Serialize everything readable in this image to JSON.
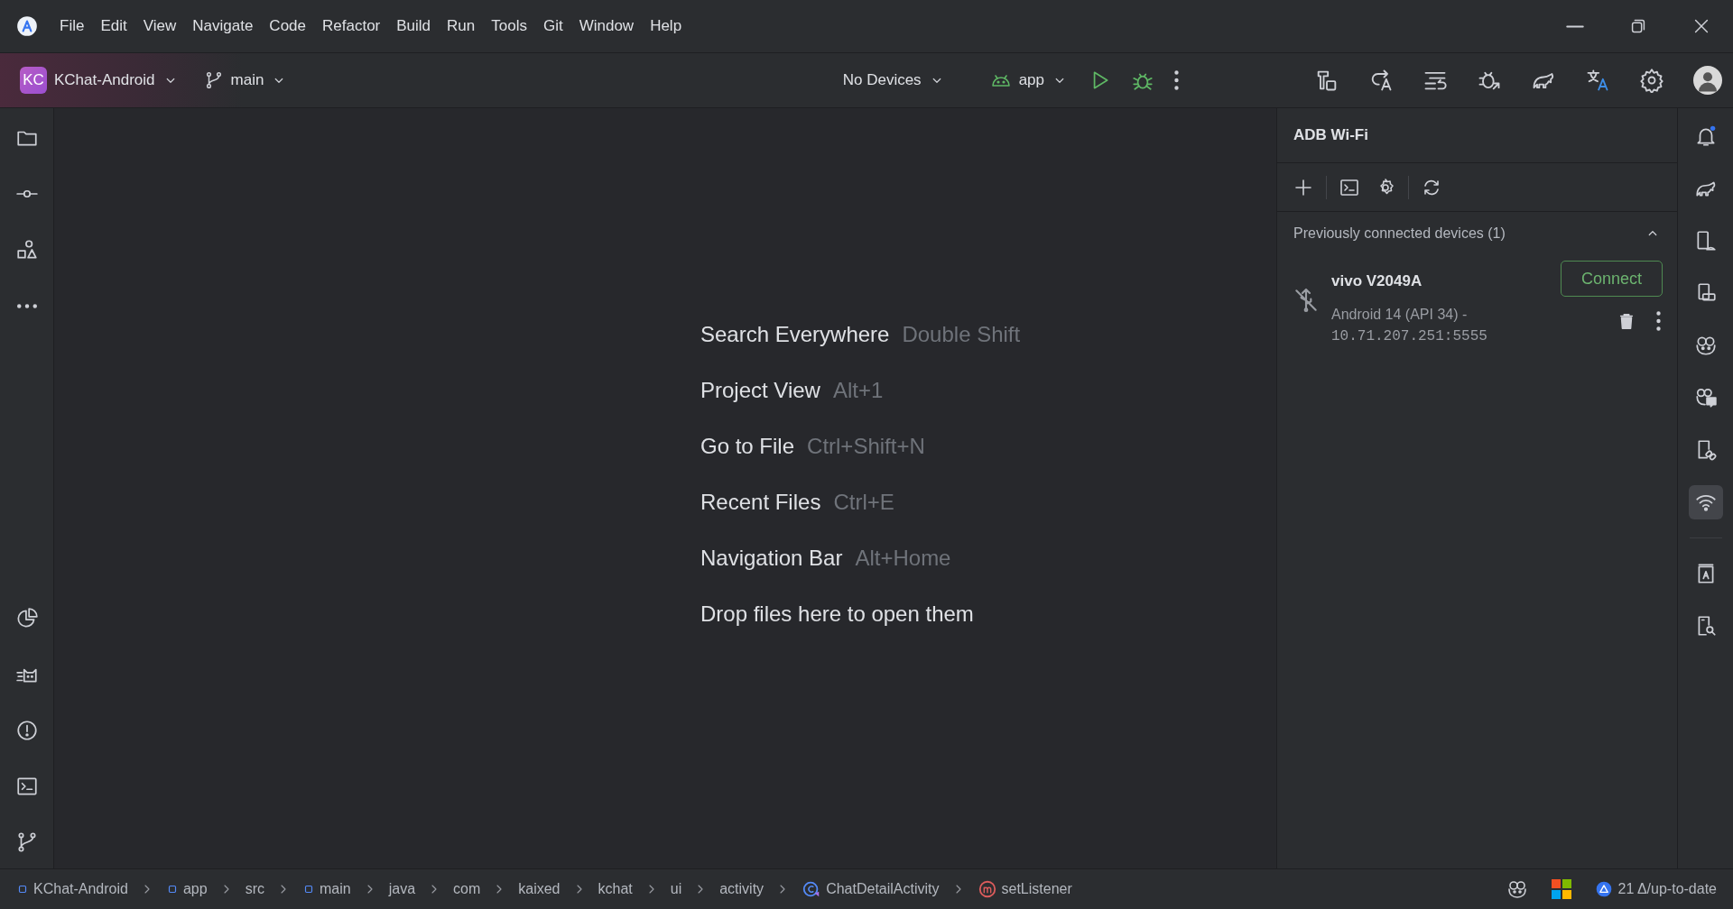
{
  "menu_bar": [
    "File",
    "Edit",
    "View",
    "Navigate",
    "Code",
    "Refactor",
    "Build",
    "Run",
    "Tools",
    "Git",
    "Window",
    "Help"
  ],
  "toolbar": {
    "project": {
      "initials": "KC",
      "name": "KChat-Android"
    },
    "branch": "main",
    "device_selector": "No Devices",
    "run_config": "app"
  },
  "left_tool_strip": [
    {
      "kind": "folder",
      "selected": false
    },
    {
      "kind": "commit",
      "selected": false
    },
    {
      "kind": "shapes",
      "selected": false
    },
    {
      "kind": "more",
      "selected": false
    },
    {
      "kind": "pie",
      "selected": false
    },
    {
      "kind": "cat",
      "selected": false
    },
    {
      "kind": "warning",
      "selected": false
    },
    {
      "kind": "terminal",
      "selected": false
    },
    {
      "kind": "branch",
      "selected": false
    }
  ],
  "editor_hints": [
    {
      "action": "Search Everywhere",
      "shortcut": "Double Shift"
    },
    {
      "action": "Project View",
      "shortcut": "Alt+1"
    },
    {
      "action": "Go to File",
      "shortcut": "Ctrl+Shift+N"
    },
    {
      "action": "Recent Files",
      "shortcut": "Ctrl+E"
    },
    {
      "action": "Navigation Bar",
      "shortcut": "Alt+Home"
    },
    {
      "action": "Drop files here to open them"
    }
  ],
  "adb_panel": {
    "title": "ADB Wi-Fi",
    "section": {
      "title": "Previously connected devices (1)",
      "expanded": true
    },
    "devices": [
      {
        "name": "vivo V2049A",
        "description": "Android 14 (API 34) -",
        "address": "10.71.207.251:5555",
        "button": "Connect"
      }
    ]
  },
  "right_tool_strip": [
    {
      "kind": "bell",
      "selected": false
    },
    {
      "kind": "elephant",
      "selected": false
    },
    {
      "kind": "phone-android",
      "selected": false
    },
    {
      "kind": "phone-screen",
      "selected": false
    },
    {
      "kind": "bot",
      "selected": false
    },
    {
      "kind": "bot-chat",
      "selected": false
    },
    {
      "kind": "phone-link",
      "selected": false
    },
    {
      "kind": "wifi",
      "selected": true
    },
    {
      "kind": "book",
      "selected": false
    },
    {
      "kind": "phone-search",
      "selected": false
    }
  ],
  "status_bar": {
    "breadcrumbs": [
      {
        "label": "KChat-Android",
        "kind": "module"
      },
      {
        "label": "app",
        "kind": "module"
      },
      {
        "label": "src",
        "kind": "plain"
      },
      {
        "label": "main",
        "kind": "module"
      },
      {
        "label": "java",
        "kind": "plain"
      },
      {
        "label": "com",
        "kind": "plain"
      },
      {
        "label": "kaixed",
        "kind": "plain"
      },
      {
        "label": "kchat",
        "kind": "plain"
      },
      {
        "label": "ui",
        "kind": "plain"
      },
      {
        "label": "activity",
        "kind": "plain"
      },
      {
        "label": "ChatDetailActivity",
        "kind": "class"
      },
      {
        "label": "setListener",
        "kind": "method"
      }
    ],
    "vcs_status": "21 Δ/up-to-date"
  }
}
